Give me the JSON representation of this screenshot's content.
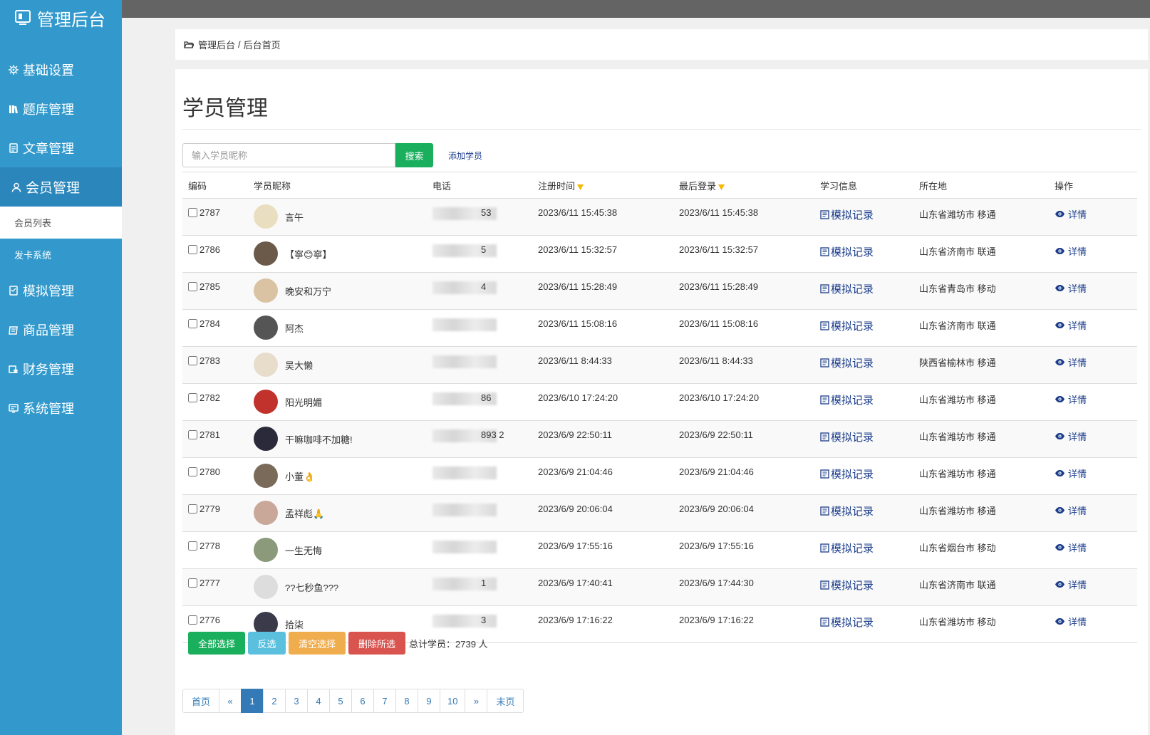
{
  "app": {
    "title": "管理后台"
  },
  "sidebar": {
    "items": [
      {
        "label": "基础设置",
        "icon": "gear-icon"
      },
      {
        "label": "题库管理",
        "icon": "books-icon"
      },
      {
        "label": "文章管理",
        "icon": "document-icon"
      },
      {
        "label": "会员管理",
        "icon": "user-icon",
        "active": true
      },
      {
        "label": "模拟管理",
        "icon": "exam-icon"
      },
      {
        "label": "商品管理",
        "icon": "goods-icon"
      },
      {
        "label": "财务管理",
        "icon": "finance-icon"
      },
      {
        "label": "系统管理",
        "icon": "system-icon"
      }
    ],
    "subitems": [
      {
        "label": "会员列表",
        "active": true
      },
      {
        "label": "发卡系统"
      }
    ]
  },
  "breadcrumb": {
    "root": "管理后台",
    "separator": "/",
    "current": "后台首页"
  },
  "page": {
    "title": "学员管理"
  },
  "search": {
    "placeholder": "输入学员昵称",
    "button": "搜索",
    "add_link": "添加学员"
  },
  "table": {
    "columns": [
      "编码",
      "学员昵称",
      "电话",
      "注册时间",
      "最后登录",
      "学习信息",
      "所在地",
      "操作"
    ],
    "mock_label": "模拟记录",
    "detail_label": "详情",
    "rows": [
      {
        "id": "2787",
        "nick": "言午",
        "phone": "53",
        "reg": "2023/6/11 15:45:38",
        "login": "2023/6/11 15:45:38",
        "loc": "山东省潍坊市 移通",
        "avatar_color": "#e9dfc0"
      },
      {
        "id": "2786",
        "nick": "【寧😊寧】",
        "phone": "5",
        "reg": "2023/6/11 15:32:57",
        "login": "2023/6/11 15:32:57",
        "loc": "山东省济南市 联通",
        "avatar_color": "#6b5a4a"
      },
      {
        "id": "2785",
        "nick": "晚安和万宁",
        "phone": "4",
        "reg": "2023/6/11 15:28:49",
        "login": "2023/6/11 15:28:49",
        "loc": "山东省青岛市 移动",
        "avatar_color": "#d9c3a3"
      },
      {
        "id": "2784",
        "nick": "阿杰",
        "phone": "",
        "reg": "2023/6/11 15:08:16",
        "login": "2023/6/11 15:08:16",
        "loc": "山东省济南市 联通",
        "avatar_color": "#555555"
      },
      {
        "id": "2783",
        "nick": "吴大懒",
        "phone": "",
        "reg": "2023/6/11 8:44:33",
        "login": "2023/6/11 8:44:33",
        "loc": "陕西省榆林市 移通",
        "avatar_color": "#e8dccb"
      },
      {
        "id": "2782",
        "nick": "阳光明媚",
        "phone": "86",
        "reg": "2023/6/10 17:24:20",
        "login": "2023/6/10 17:24:20",
        "loc": "山东省潍坊市 移通",
        "avatar_color": "#c0322b"
      },
      {
        "id": "2781",
        "nick": "干嘛咖啡不加糖!",
        "phone": "893 2",
        "reg": "2023/6/9 22:50:11",
        "login": "2023/6/9 22:50:11",
        "loc": "山东省潍坊市 移通",
        "avatar_color": "#2a2a3a"
      },
      {
        "id": "2780",
        "nick": "小董👌",
        "phone": "",
        "reg": "2023/6/9 21:04:46",
        "login": "2023/6/9 21:04:46",
        "loc": "山东省潍坊市 移通",
        "avatar_color": "#7a6a5a"
      },
      {
        "id": "2779",
        "nick": "孟祥彪🙏",
        "phone": "",
        "reg": "2023/6/9 20:06:04",
        "login": "2023/6/9 20:06:04",
        "loc": "山东省潍坊市 移通",
        "avatar_color": "#c9a899"
      },
      {
        "id": "2778",
        "nick": "一生无悔",
        "phone": "",
        "reg": "2023/6/9 17:55:16",
        "login": "2023/6/9 17:55:16",
        "loc": "山东省烟台市 移动",
        "avatar_color": "#8a9a7a"
      },
      {
        "id": "2777",
        "nick": "??七秒鱼???",
        "phone": "1",
        "reg": "2023/6/9 17:40:41",
        "login": "2023/6/9 17:44:30",
        "loc": "山东省济南市 联通",
        "avatar_color": "#dddddd"
      },
      {
        "id": "2776",
        "nick": "拾柒",
        "phone": "3",
        "reg": "2023/6/9 17:16:22",
        "login": "2023/6/9 17:16:22",
        "loc": "山东省潍坊市 移动",
        "avatar_color": "#3a3a4a"
      }
    ]
  },
  "bulk": {
    "select_all": "全部选择",
    "invert": "反选",
    "clear": "清空选择",
    "delete": "删除所选",
    "total_label": "总计学员：",
    "total_count": "2739",
    "total_unit": "人"
  },
  "pagination": {
    "first": "首页",
    "prev": "«",
    "pages": [
      "1",
      "2",
      "3",
      "4",
      "5",
      "6",
      "7",
      "8",
      "9",
      "10"
    ],
    "current": "1",
    "next": "»",
    "last": "末页"
  },
  "colors": {
    "sidebar": "#3399cc",
    "sidebar_active": "#2b86bb",
    "topbar": "#646464",
    "accent_green": "#1aaf5d",
    "link": "#1a3c8a",
    "pager_active": "#337ab7"
  }
}
